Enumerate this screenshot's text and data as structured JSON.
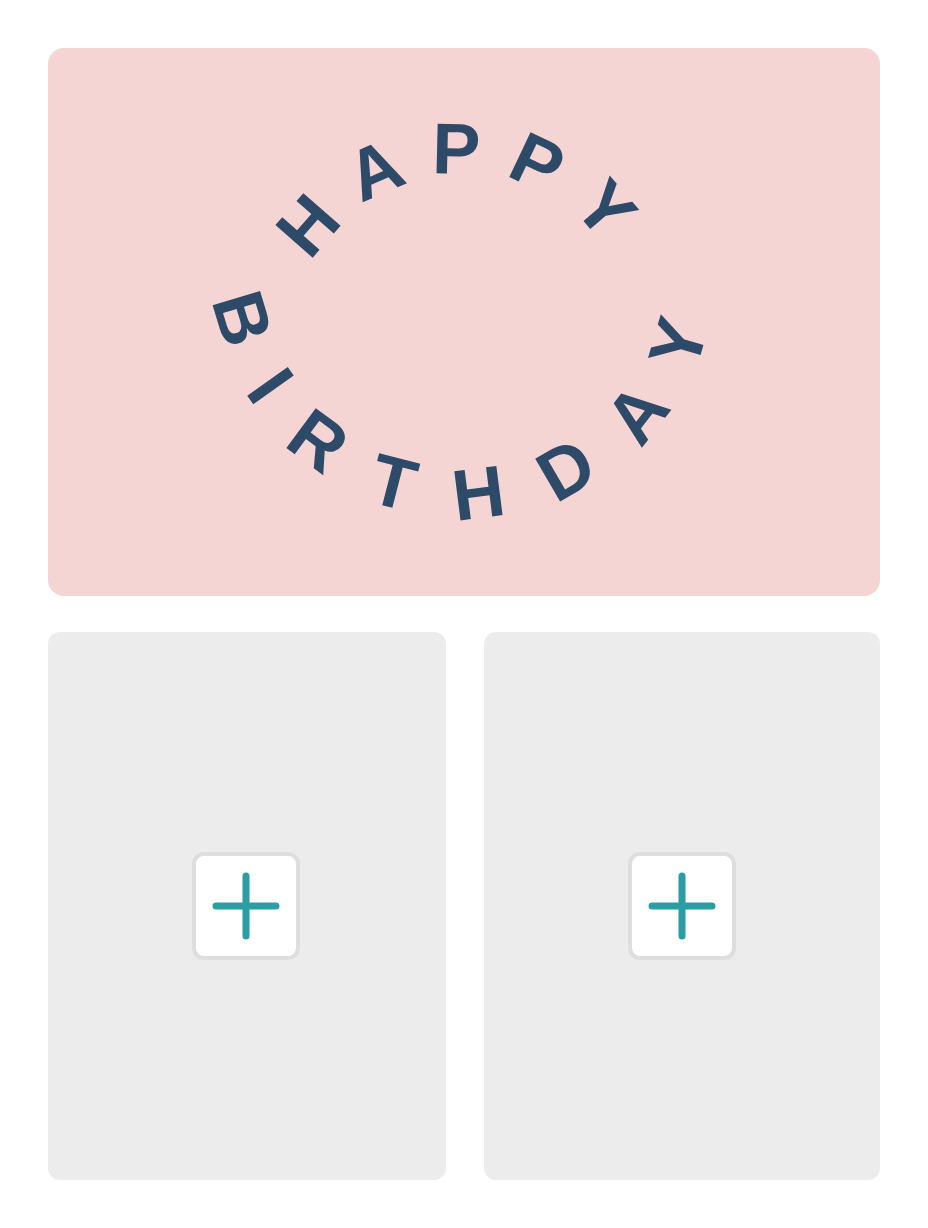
{
  "card": {
    "greeting_top": "HAPPY",
    "greeting_bottom": "BIRTHDAY"
  },
  "photo_slots": [
    {
      "kind": "empty"
    },
    {
      "kind": "empty"
    }
  ]
}
